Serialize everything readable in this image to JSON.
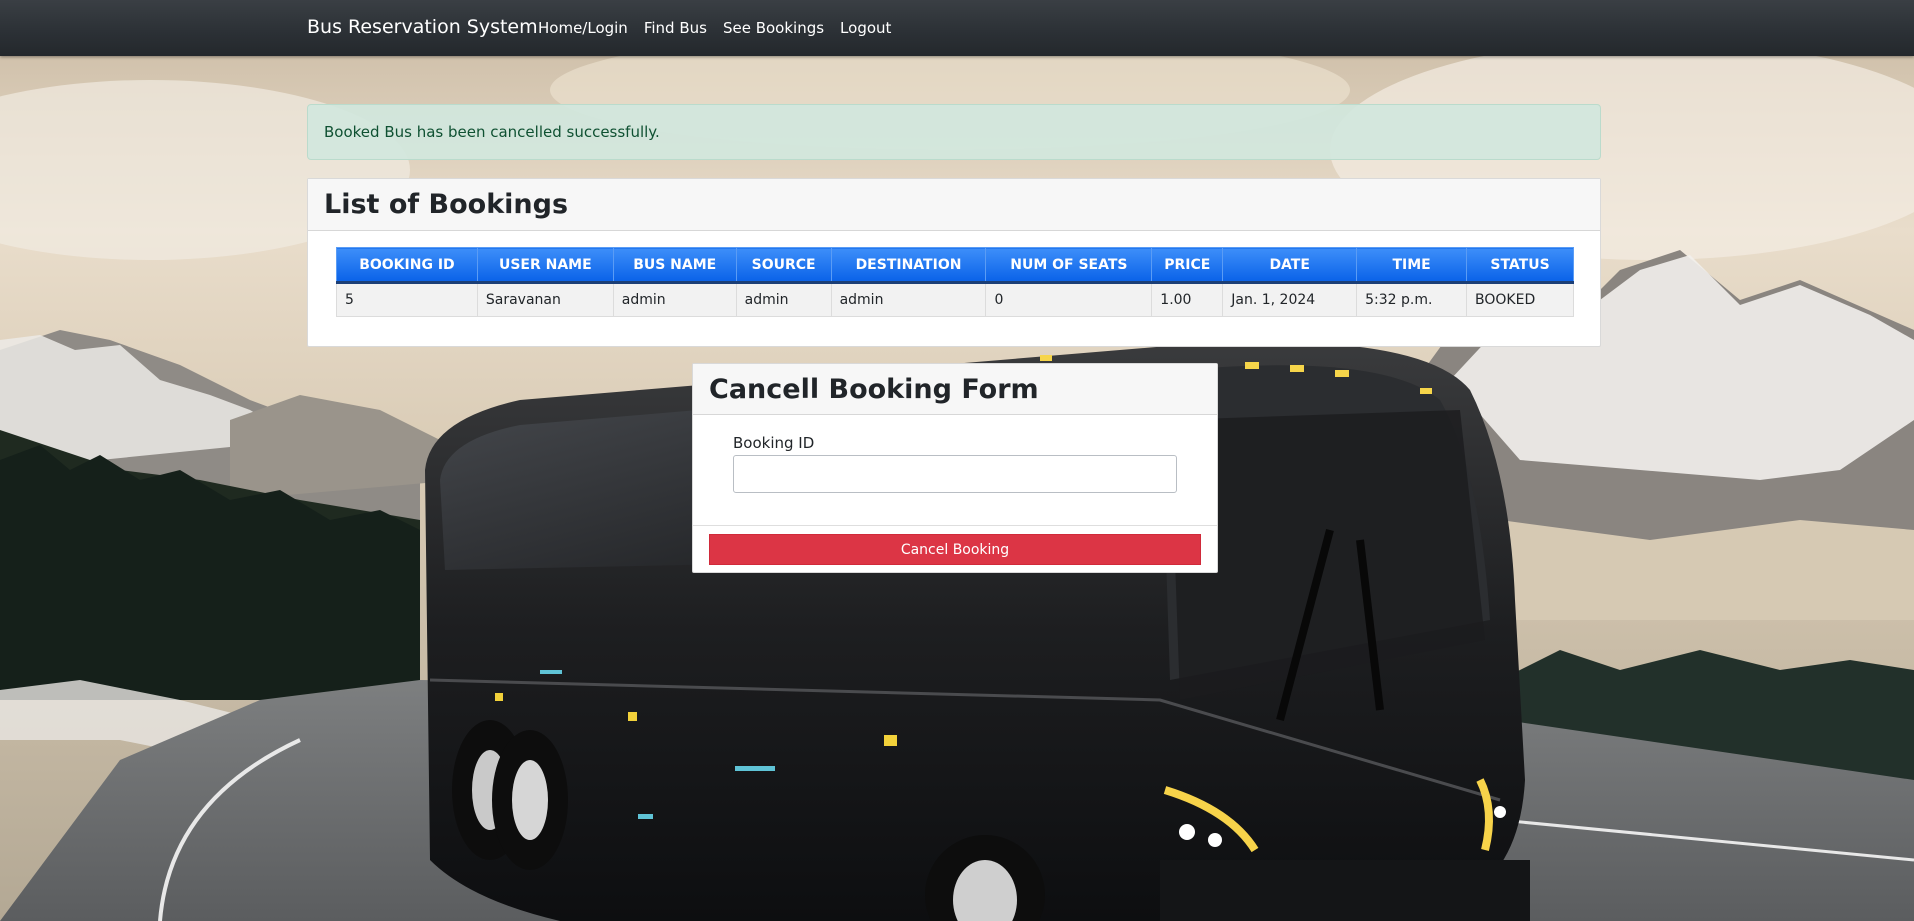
{
  "navbar": {
    "brand": "Bus Reservation System",
    "links": [
      "Home/Login",
      "Find Bus",
      "See Bookings",
      "Logout"
    ]
  },
  "alert": {
    "message": "Booked Bus has been cancelled successfully."
  },
  "bookings": {
    "title": "List of Bookings",
    "columns": [
      "BOOKING ID",
      "USER NAME",
      "BUS NAME",
      "SOURCE",
      "DESTINATION",
      "NUM OF SEATS",
      "PRICE",
      "DATE",
      "TIME",
      "STATUS"
    ],
    "rows": [
      [
        "5",
        "Saravanan",
        "admin",
        "admin",
        "admin",
        "0",
        "1.00",
        "Jan. 1, 2024",
        "5:32 p.m.",
        "BOOKED"
      ]
    ]
  },
  "cancel_form": {
    "title": "Cancell Booking Form",
    "booking_id_label": "Booking ID",
    "booking_id_value": "",
    "button_label": "Cancel Booking"
  },
  "colors": {
    "navbar": "#2b3035",
    "alert_bg": "#d1e7dd",
    "table_header": "#0d6efd",
    "cancel_button": "#dc3545"
  }
}
